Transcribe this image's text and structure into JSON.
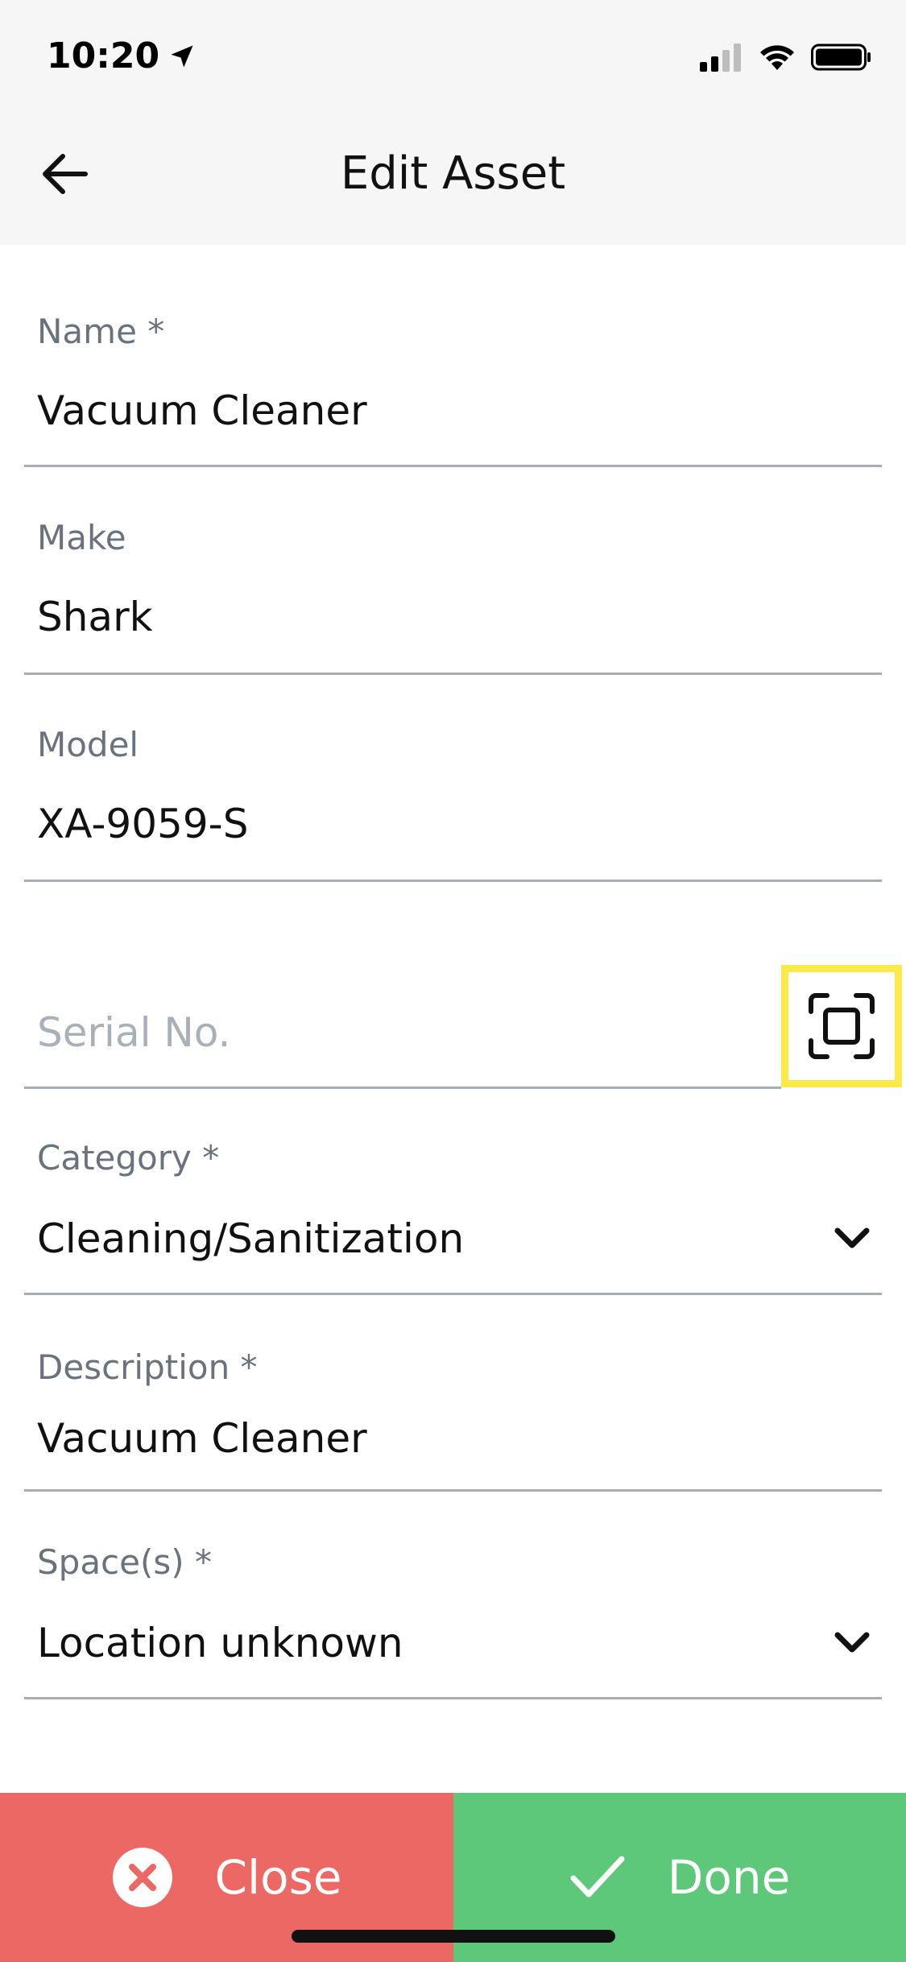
{
  "status_bar": {
    "time": "10:20"
  },
  "header": {
    "title": "Edit Asset"
  },
  "form": {
    "name": {
      "label": "Name *",
      "value": "Vacuum Cleaner"
    },
    "make": {
      "label": "Make",
      "value": "Shark"
    },
    "model": {
      "label": "Model",
      "value": "XA-9059-S"
    },
    "serial": {
      "placeholder": "Serial No.",
      "value": ""
    },
    "category": {
      "label": "Category *",
      "value": "Cleaning/Sanitization"
    },
    "description": {
      "label": "Description *",
      "value": "Vacuum Cleaner"
    },
    "spaces": {
      "label": "Space(s) *",
      "value": "Location unknown"
    }
  },
  "actions": {
    "close_label": "Close",
    "done_label": "Done"
  },
  "colors": {
    "header_bg": "#f6f6f6",
    "close_bg": "#eb6864",
    "done_bg": "#5ec87a",
    "highlight": "#fde94a",
    "label": "#69727d",
    "placeholder": "#a9b0b8"
  },
  "icons": {
    "back": "arrow-left-icon",
    "scan": "scan-frame-icon",
    "dropdown": "chevron-down-icon",
    "close": "x-circle-icon",
    "done": "check-icon"
  }
}
